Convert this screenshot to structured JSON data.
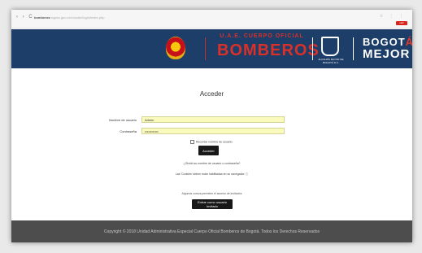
{
  "browser": {
    "nav_glyphs": "‹ › C",
    "url_host": "bomberos",
    "url_rest": "bogota.gov.co/moodle/login/index.php",
    "controls": "☆ ⋮ ⋮",
    "badge_label": "salir"
  },
  "banner": {
    "org_line": "U.A.E. CUERPO OFICIAL",
    "org_name": "BOMBEROS",
    "crest_caption": "ALCALDÍA MAYOR DE BOGOTÁ D.C.",
    "brand_bogo": "BOGOT",
    "brand_accent": "Á",
    "brand_bottom": "MEJOR"
  },
  "login": {
    "title": "Acceder",
    "username_label": "Nombre de usuario",
    "username_value": "Admin",
    "password_label": "Contraseña",
    "password_value": "••••••••••••",
    "remember_label": "Recordar nombre de usuario",
    "submit_label": "Acceder",
    "forgot_link": "¿Olvidó su nombre de usuario o contraseña?",
    "cookies_notice": "Las 'Cookies' deben estar habilitadas en su navegador ⓘ",
    "guest_notice": "Algunos cursos permiten el acceso de invitados",
    "guest_button": "Entrar como usuario invitado"
  },
  "footer": {
    "copyright": "Copyright © 2018 Unidad Administrativa Especial Cuerpo Oficial Bomberos de Bogotá. Todos los Derechos Reservados"
  },
  "colors": {
    "banner_bg": "#1d3e69",
    "brand_red": "#d8312a",
    "field_bg": "#fafabd",
    "button_bg": "#181818",
    "footer_bg": "#4d4d4d"
  }
}
